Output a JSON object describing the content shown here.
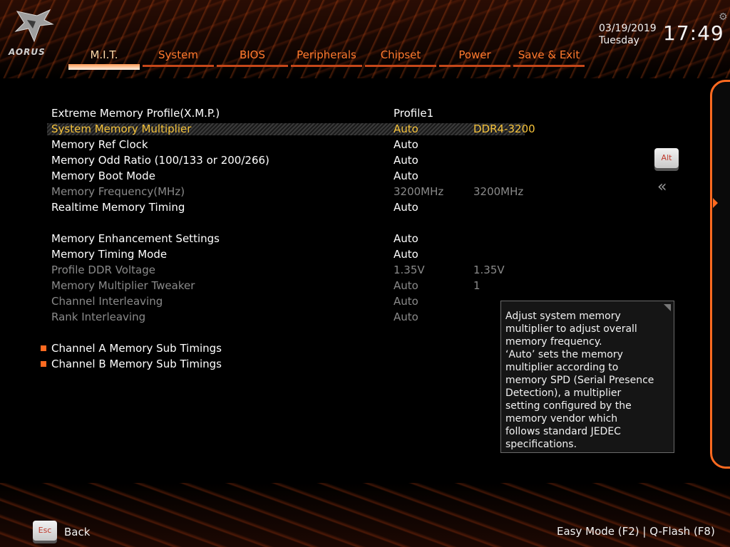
{
  "brand": {
    "logo_text": "AORUS"
  },
  "clock": {
    "date": "03/19/2019",
    "weekday": "Tuesday",
    "time": "17:49"
  },
  "tabs": [
    {
      "label": "M.I.T.",
      "active": true
    },
    {
      "label": "System"
    },
    {
      "label": "BIOS"
    },
    {
      "label": "Peripherals"
    },
    {
      "label": "Chipset"
    },
    {
      "label": "Power"
    },
    {
      "label": "Save & Exit"
    }
  ],
  "settings": [
    {
      "label": "Extreme Memory Profile(X.M.P.)",
      "value": "Profile1",
      "value2": ""
    },
    {
      "label": "System Memory Multiplier",
      "value": "Auto",
      "value2": "DDR4-3200",
      "selected": true
    },
    {
      "label": "Memory Ref Clock",
      "value": "Auto",
      "value2": ""
    },
    {
      "label": "Memory Odd Ratio (100/133 or 200/266)",
      "value": "Auto",
      "value2": ""
    },
    {
      "label": "Memory Boot Mode",
      "value": "Auto",
      "value2": ""
    },
    {
      "label": "Memory Frequency(MHz)",
      "value": "3200MHz",
      "value2": "3200MHz",
      "disabled": true
    },
    {
      "label": "Realtime Memory Timing",
      "value": "Auto",
      "value2": ""
    },
    {
      "label": "Memory Enhancement Settings",
      "value": "Auto",
      "value2": ""
    },
    {
      "label": "Memory Timing Mode",
      "value": "Auto",
      "value2": ""
    },
    {
      "label": "Profile DDR Voltage",
      "value": "1.35V",
      "value2": "1.35V",
      "disabled": true
    },
    {
      "label": "Memory Multiplier Tweaker",
      "value": "Auto",
      "value2": "1",
      "disabled": true
    },
    {
      "label": "Channel Interleaving",
      "value": "Auto",
      "value2": "",
      "disabled": true
    },
    {
      "label": "Rank Interleaving",
      "value": "Auto",
      "value2": "",
      "disabled": true
    }
  ],
  "submenus": [
    {
      "label": "Channel A Memory Sub Timings"
    },
    {
      "label": "Channel B Memory Sub Timings"
    }
  ],
  "help": {
    "lines": [
      "Adjust system memory",
      "multiplier to adjust overall",
      "memory frequency.",
      "‘Auto’ sets the memory",
      "multiplier according to",
      "memory SPD (Serial Presence",
      "Detection), a multiplier",
      "setting configured by the",
      "memory vendor which",
      "follows standard JEDEC",
      "specifications."
    ]
  },
  "keys": {
    "alt": "Alt",
    "esc": "Esc"
  },
  "footer": {
    "back": "Back",
    "right": "Easy Mode (F2)  |  Q-Flash (F8)"
  },
  "colors": {
    "accent": "#ff6a20",
    "selected_text": "#f5c23a",
    "disabled_text": "#8a8a8a"
  }
}
